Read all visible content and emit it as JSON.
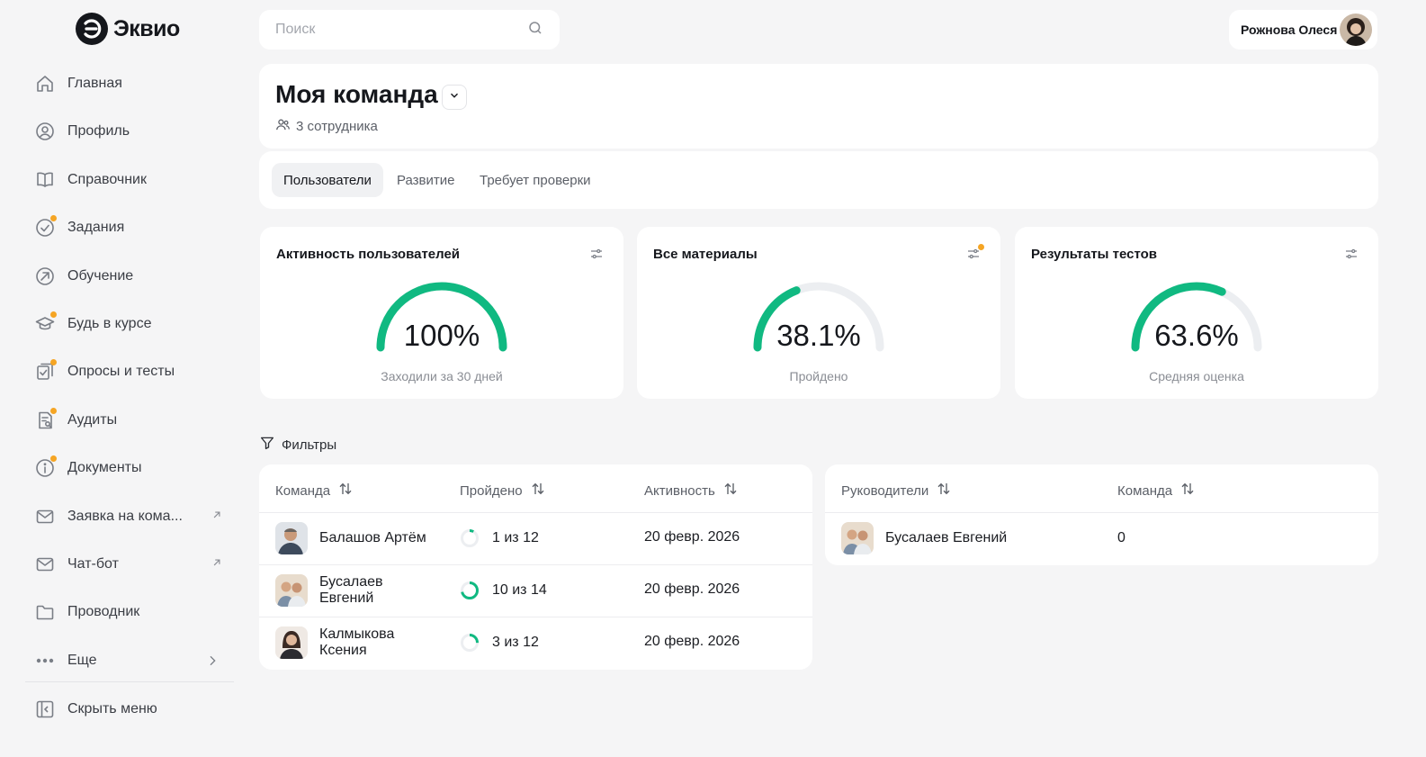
{
  "app": {
    "brand": "Эквио"
  },
  "sidebar": {
    "items": [
      {
        "label": "Главная",
        "icon": "home-icon",
        "dot": false
      },
      {
        "label": "Профиль",
        "icon": "user-circle-icon",
        "dot": false
      },
      {
        "label": "Справочник",
        "icon": "book-icon",
        "dot": false
      },
      {
        "label": "Задания",
        "icon": "check-circle-icon",
        "dot": true
      },
      {
        "label": "Обучение",
        "icon": "learning-icon",
        "dot": false
      },
      {
        "label": "Будь в курсе",
        "icon": "graduation-cap-icon",
        "dot": true
      },
      {
        "label": "Опросы и тесты",
        "icon": "survey-icon",
        "dot": true
      },
      {
        "label": "Аудиты",
        "icon": "audit-icon",
        "dot": true
      },
      {
        "label": "Документы",
        "icon": "info-icon",
        "dot": true
      },
      {
        "label": "Заявка на кома...",
        "icon": "mail-icon",
        "dot": false,
        "external": true
      },
      {
        "label": "Чат-бот",
        "icon": "mail-icon",
        "dot": false,
        "external": true
      },
      {
        "label": "Проводник",
        "icon": "folder-icon",
        "dot": false
      },
      {
        "label": "Еще",
        "icon": "more-dots-icon",
        "dot": false,
        "chevron": true
      }
    ],
    "collapse_label": "Скрыть меню"
  },
  "search": {
    "placeholder": "Поиск"
  },
  "user": {
    "name": "Рожнова Олеся"
  },
  "header": {
    "title": "Моя команда",
    "employees": "3 сотрудника"
  },
  "tabs": [
    {
      "label": "Пользователи",
      "active": true
    },
    {
      "label": "Развитие",
      "active": false
    },
    {
      "label": "Требует проверки",
      "active": false
    }
  ],
  "stats": [
    {
      "title": "Активность пользователей",
      "value": "100%",
      "fraction": 1.0,
      "subtitle": "Заходили за 30 дней",
      "dot": false
    },
    {
      "title": "Все материалы",
      "value": "38.1%",
      "fraction": 0.381,
      "subtitle": "Пройдено",
      "dot": true
    },
    {
      "title": "Результаты тестов",
      "value": "63.6%",
      "fraction": 0.636,
      "subtitle": "Средняя оценка",
      "dot": false
    }
  ],
  "filters": {
    "label": "Фильтры"
  },
  "team_table": {
    "headers": [
      "Команда",
      "Пройдено",
      "Активность"
    ],
    "rows": [
      {
        "name": "Балашов Артём",
        "progress": "1 из 12",
        "fraction": 0.083,
        "activity": "20 февр. 2026"
      },
      {
        "name": "Бусалаев Евгений",
        "progress": "10 из 14",
        "fraction": 0.714,
        "activity": "20 февр. 2026"
      },
      {
        "name": "Калмыкова Ксения",
        "progress": "3 из 12",
        "fraction": 0.25,
        "activity": "20 февр. 2026"
      }
    ]
  },
  "managers_table": {
    "headers": [
      "Руководители",
      "Команда"
    ],
    "rows": [
      {
        "name": "Бусалаев Евгений",
        "team": "0"
      }
    ]
  },
  "colors": {
    "accent": "#10b981",
    "track": "#eceef1",
    "dot": "#f5a524"
  }
}
